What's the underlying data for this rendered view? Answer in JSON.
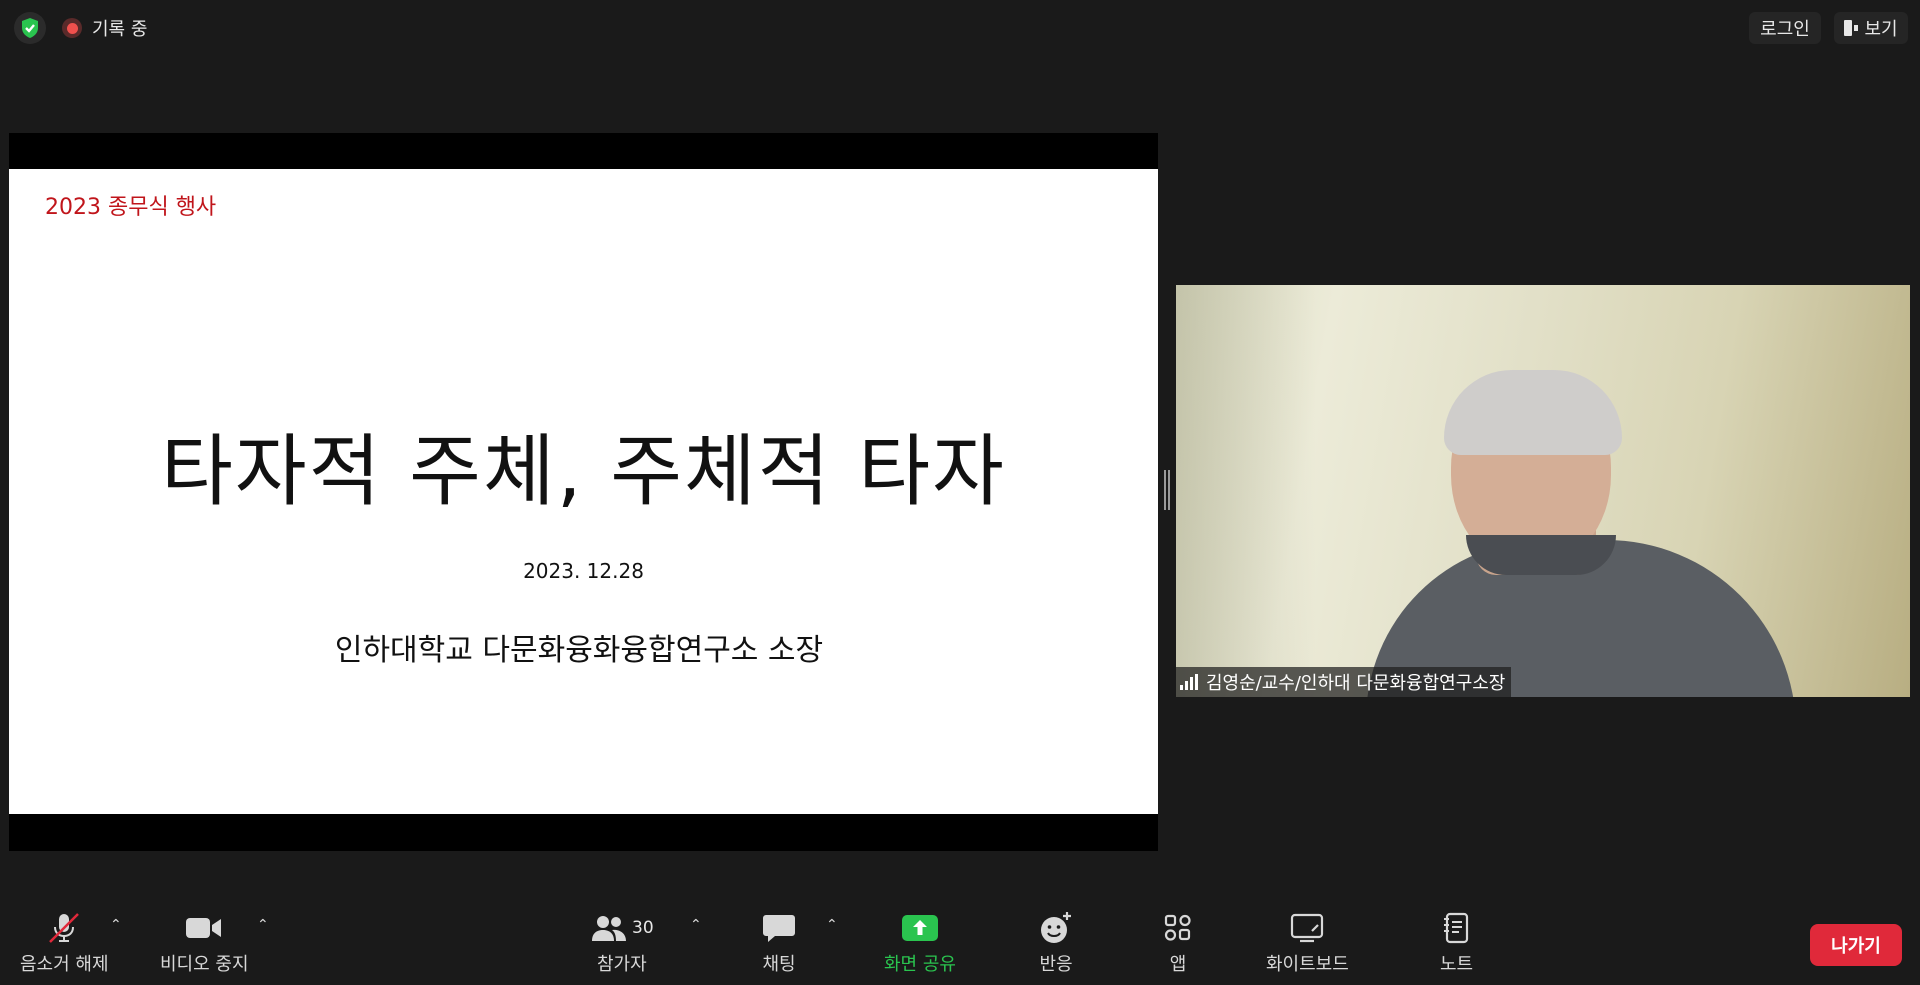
{
  "top_bar": {
    "recording_text": "기록 중",
    "login_label": "로그인",
    "view_label": "보기"
  },
  "slide": {
    "tag": "2023 종무식 행사",
    "title": "타자적 주체, 주체적 타자",
    "date": "2023. 12.28",
    "organization": "인하대학교 다문화융화융합연구소 소장"
  },
  "participant": {
    "name": "김영순/교수/인하대 다문화융합연구소장"
  },
  "toolbar": {
    "mute_label": "음소거 해제",
    "video_label": "비디오 중지",
    "participants_label": "참가자",
    "participants_count": "30",
    "chat_label": "채팅",
    "share_label": "화면 공유",
    "reactions_label": "반응",
    "apps_label": "앱",
    "whiteboard_label": "화이트보드",
    "notes_label": "노트",
    "leave_label": "나가기"
  },
  "colors": {
    "background": "#1a1a1a",
    "share_green": "#2ac44f",
    "leave_red": "#e0293a",
    "slide_tag_red": "#c0151b"
  },
  "icons": [
    "shield-check-icon",
    "record-icon",
    "view-icon",
    "mic-off-icon",
    "video-icon",
    "participants-icon",
    "chat-icon",
    "share-screen-icon",
    "reaction-icon",
    "apps-icon",
    "whiteboard-icon",
    "notes-icon",
    "signal-icon"
  ]
}
